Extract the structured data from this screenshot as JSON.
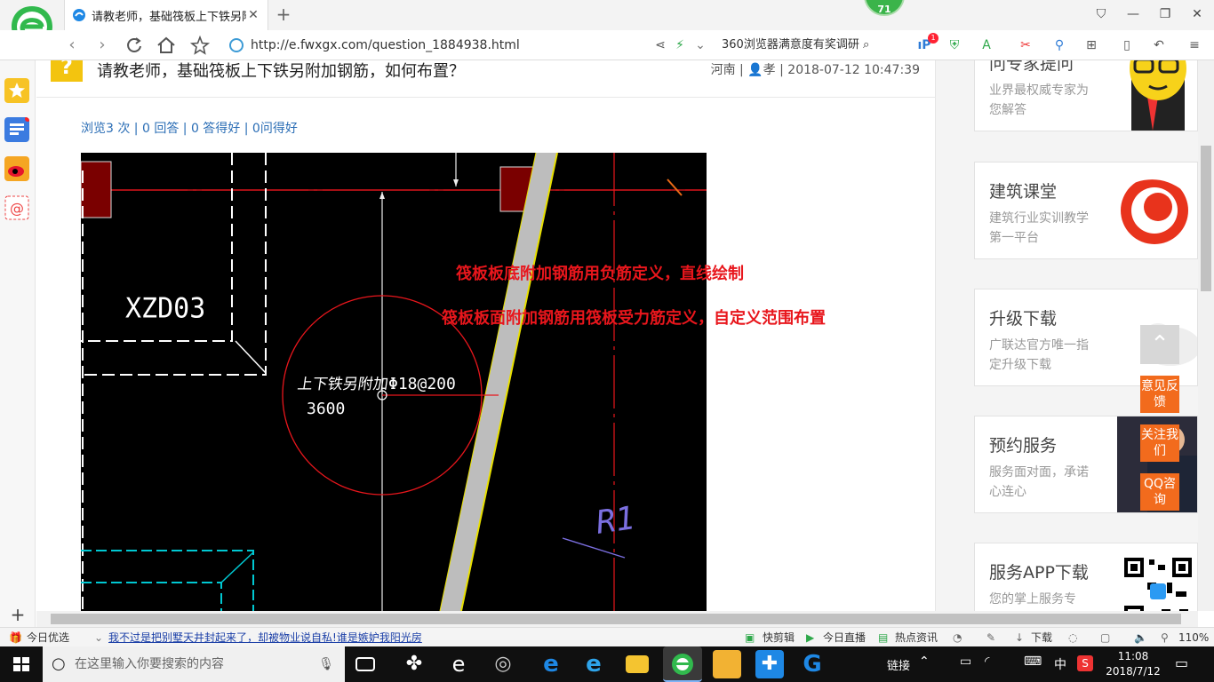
{
  "browser": {
    "tab_title": "请教老师，基础筏板上下铁另附加",
    "tab_close": "✕",
    "new_tab": "+",
    "score_badge": "71",
    "url": "http://e.fwxgx.com/question_1884938.html",
    "search_text": "360浏览器满意度有奖调研",
    "win_controls": [
      "⛉",
      "—",
      "❐",
      "✕"
    ],
    "notification_count": "1"
  },
  "question": {
    "icon_text": "?",
    "title": "请教老师，基础筏板上下铁另附加钢筋，如何布置？",
    "meta_region": "河南",
    "meta_user": "孝",
    "meta_time": "2018-07-12 10:47:39",
    "stats": "浏览3 次 | 0 回答 | 0 答得好 | 0问得好"
  },
  "cad": {
    "label_xzd": "XZD03",
    "label_rebar_name": "上下铁另附加",
    "label_length": "3600",
    "label_spec": "Φ18@200",
    "label_r1": "R1",
    "annotation_1": "筏板板底附加钢筋用负筋定义，直线绘制",
    "annotation_2": "筏板板面附加钢筋用筏板受力筋定义，自定义范围布置",
    "colors": {
      "background": "#000000",
      "red": "#e8161c",
      "dark_red_fill": "#7a0000",
      "cyan": "#00c8d2",
      "slab_line": "#c8c8c8"
    }
  },
  "right_column": {
    "cards": [
      {
        "title": "问专家提问",
        "desc": "业界最权威专家为您解答"
      },
      {
        "title": "建筑课堂",
        "desc": "建筑行业实训教学第一平台"
      },
      {
        "title": "升级下载",
        "desc": "广联达官方唯一指定升级下载"
      },
      {
        "title": "预约服务",
        "desc": "服务面对面，承诺心连心"
      },
      {
        "title": "服务APP下载",
        "desc": "您的掌上服务专"
      }
    ],
    "float_buttons": [
      "意见反馈",
      "关注我们",
      "QQ咨询"
    ]
  },
  "statusbar": {
    "today": "今日优选",
    "news": "我不过是把别墅天井封起来了，却被物业说自私!谁是嫉妒我阳光房",
    "quick_cut": "快剪辑",
    "live": "今日直播",
    "hot": "热点资讯",
    "download": "下载",
    "zoom": "110%"
  },
  "taskbar": {
    "search_placeholder": "在这里输入你要搜索的内容",
    "links": "链接",
    "ime": "中",
    "time": "11:08",
    "date": "2018/7/12"
  }
}
